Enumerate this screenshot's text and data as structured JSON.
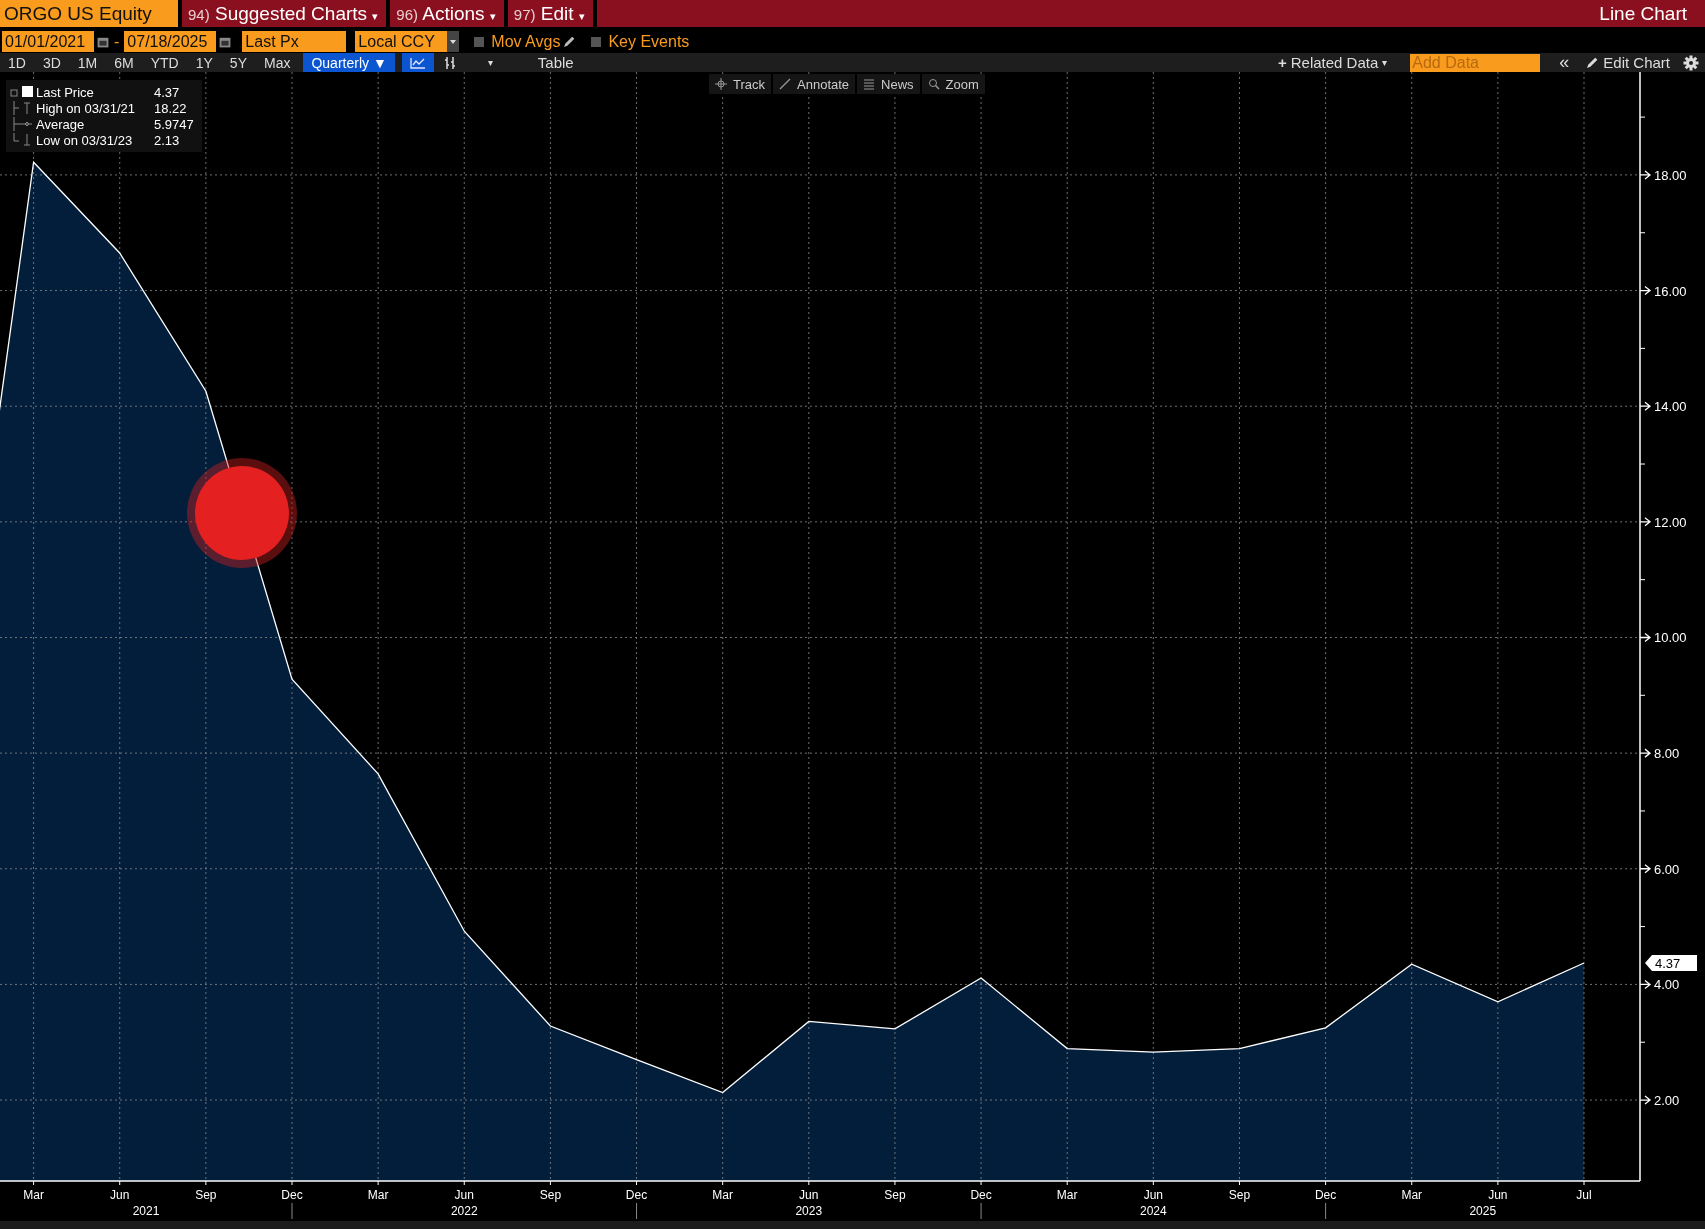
{
  "header": {
    "security": "ORGO US Equity",
    "menus": [
      {
        "number": "94)",
        "label": "Suggested Charts",
        "caret": "▾"
      },
      {
        "number": "96)",
        "label": "Actions",
        "caret": "▾"
      },
      {
        "number": "97)",
        "label": "Edit",
        "caret": "▾"
      }
    ],
    "title": "Line Chart"
  },
  "controls": {
    "start_date": "01/01/2021",
    "separator": "-",
    "end_date": "07/18/2025",
    "field": "Last Px",
    "currency": "Local CCY",
    "checkboxes": [
      {
        "label": "Mov Avgs",
        "checked": false,
        "kind": "editable"
      },
      {
        "label": "Key Events",
        "checked": false,
        "kind": "plain"
      }
    ]
  },
  "toolbar": {
    "periods": [
      {
        "label": "1D",
        "selected": false
      },
      {
        "label": "3D",
        "selected": false
      },
      {
        "label": "1M",
        "selected": false
      },
      {
        "label": "6M",
        "selected": false
      },
      {
        "label": "YTD",
        "selected": false
      },
      {
        "label": "1Y",
        "selected": false
      },
      {
        "label": "5Y",
        "selected": false
      },
      {
        "label": "Max",
        "selected": false
      }
    ],
    "frequency": {
      "label": "Quarterly",
      "caret": "▼"
    },
    "chart_types": [
      {
        "kind": "line",
        "selected": true
      },
      {
        "kind": "bar",
        "selected": false
      }
    ],
    "more_caret": "▾",
    "table_button": "Table",
    "related_data": {
      "plus": "+",
      "label": "Related Data",
      "caret": "▾"
    },
    "add_data": {
      "placeholder": "Add Data"
    },
    "collapse": "«",
    "edit_chart": "Edit Chart"
  },
  "chart_tools": [
    {
      "kind": "track",
      "label": "Track"
    },
    {
      "kind": "annotate",
      "label": "Annotate"
    },
    {
      "kind": "news",
      "label": "News"
    },
    {
      "kind": "zoom",
      "label": "Zoom"
    }
  ],
  "legend": [
    {
      "kind": "line",
      "value": "4.37"
    },
    {
      "kind": "high",
      "label": "High on 03/31/21",
      "value": "18.22"
    },
    {
      "kind": "average",
      "label": "Average",
      "value": "5.9747"
    },
    {
      "kind": "low",
      "label": "Low on 03/31/23",
      "value": "2.13"
    }
  ],
  "last_price_tag": "4.37",
  "year_labels": [
    "2021",
    "2022",
    "2023",
    "2024",
    "2025"
  ],
  "chart_data": {
    "type": "area",
    "categories": [
      null,
      "Mar",
      "Jun",
      "Sep",
      "Dec",
      "Mar",
      "Jun",
      "Sep",
      "Dec",
      "Mar",
      "Jun",
      "Sep",
      "Dec",
      "Mar",
      "Jun",
      "Sep",
      "Dec",
      "Mar",
      "Jun",
      "Jul"
    ],
    "series": [
      {
        "name": "Last Price",
        "color": "#ffffff",
        "values": [
          7.4,
          18.22,
          16.65,
          14.26,
          9.28,
          7.64,
          4.92,
          3.28,
          2.7,
          2.13,
          3.36,
          3.23,
          4.11,
          2.89,
          2.83,
          2.89,
          3.25,
          4.35,
          3.7,
          4.37
        ]
      }
    ],
    "grid": true,
    "ylim": [
      0.6,
      19.78
    ],
    "yticks": [
      {
        "value": 2,
        "label": "2.00"
      },
      {
        "value": 4,
        "label": "4.00"
      },
      {
        "value": 6,
        "label": "6.00"
      },
      {
        "value": 8,
        "label": "8.00"
      },
      {
        "value": 10,
        "label": "10.00"
      },
      {
        "value": 12,
        "label": "12.00"
      },
      {
        "value": 14,
        "label": "14.00"
      },
      {
        "value": 16,
        "label": "16.00"
      },
      {
        "value": 18,
        "label": "18.00"
      }
    ]
  }
}
